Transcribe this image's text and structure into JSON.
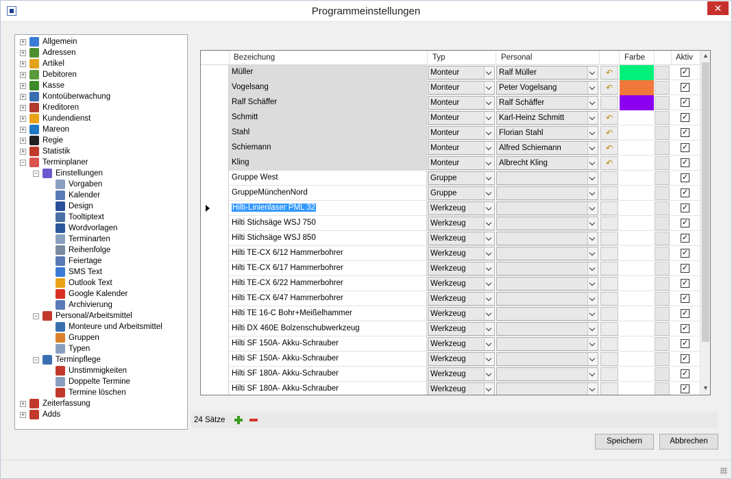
{
  "window": {
    "title": "Programmeinstellungen",
    "close_label": "✕"
  },
  "tree": {
    "nodes": [
      {
        "label": "Allgemein",
        "level": 0,
        "expander": "+",
        "icon": "grid-icon",
        "color": "#3a7bd5"
      },
      {
        "label": "Adressen",
        "level": 0,
        "expander": "+",
        "icon": "people-icon",
        "color": "#4f8f2f"
      },
      {
        "label": "Artikel",
        "level": 0,
        "expander": "+",
        "icon": "gear-sun-icon",
        "color": "#e3a21a"
      },
      {
        "label": "Debitoren",
        "level": 0,
        "expander": "+",
        "icon": "book-icon",
        "color": "#5a9a3a"
      },
      {
        "label": "Kasse",
        "level": 0,
        "expander": "+",
        "icon": "cash-icon",
        "color": "#3d8a2a"
      },
      {
        "label": "Kontoüberwachung",
        "level": 0,
        "expander": "+",
        "icon": "monitor-icon",
        "color": "#3a6fb0"
      },
      {
        "label": "Kreditoren",
        "level": 0,
        "expander": "+",
        "icon": "books-icon",
        "color": "#b03a2e"
      },
      {
        "label": "Kundendienst",
        "level": 0,
        "expander": "+",
        "icon": "service-icon",
        "color": "#e8a317"
      },
      {
        "label": "Mareon",
        "level": 0,
        "expander": "+",
        "icon": "mareon-icon",
        "color": "#1d7ac7"
      },
      {
        "label": "Regie",
        "level": 0,
        "expander": "+",
        "icon": "clapper-icon",
        "color": "#222222"
      },
      {
        "label": "Statistik",
        "level": 0,
        "expander": "+",
        "icon": "chart-icon",
        "color": "#c0392b"
      },
      {
        "label": "Terminplaner",
        "level": 0,
        "expander": "−",
        "icon": "planner-icon",
        "color": "#d9534f"
      },
      {
        "label": "Einstellungen",
        "level": 1,
        "expander": "−",
        "icon": "settings-icon",
        "color": "#6a5acd"
      },
      {
        "label": "Vorgaben",
        "level": 2,
        "expander": "",
        "icon": "document-icon",
        "color": "#8aa0c0"
      },
      {
        "label": "Kalender",
        "level": 2,
        "expander": "",
        "icon": "calendar-icon",
        "color": "#5a7ab5"
      },
      {
        "label": "Design",
        "level": 2,
        "expander": "",
        "icon": "brush-icon",
        "color": "#2a4f9a"
      },
      {
        "label": "Tooltiptext",
        "level": 2,
        "expander": "",
        "icon": "tooltip-icon",
        "color": "#4a6fa5"
      },
      {
        "label": "Wordvorlagen",
        "level": 2,
        "expander": "",
        "icon": "word-icon",
        "color": "#2b579a"
      },
      {
        "label": "Terminarten",
        "level": 2,
        "expander": "",
        "icon": "document-icon",
        "color": "#8aa0c0"
      },
      {
        "label": "Reihenfolge",
        "level": 2,
        "expander": "",
        "icon": "list-icon",
        "color": "#7a8aa0"
      },
      {
        "label": "Feiertage",
        "level": 2,
        "expander": "",
        "icon": "holiday-icon",
        "color": "#5a7ab5"
      },
      {
        "label": "SMS Text",
        "level": 2,
        "expander": "",
        "icon": "phone-icon",
        "color": "#3a7bd5"
      },
      {
        "label": "Outlook Text",
        "level": 2,
        "expander": "",
        "icon": "envelope-icon",
        "color": "#e8a317"
      },
      {
        "label": "Google Kalender",
        "level": 2,
        "expander": "",
        "icon": "google-icon",
        "color": "#d93025"
      },
      {
        "label": "Archivierung",
        "level": 2,
        "expander": "",
        "icon": "archive-icon",
        "color": "#5a7ab5"
      },
      {
        "label": "Personal/Arbeitsmittel",
        "level": 1,
        "expander": "−",
        "icon": "tools-icon",
        "color": "#c0392b"
      },
      {
        "label": "Monteure und Arbeitsmittel",
        "level": 2,
        "expander": "",
        "icon": "worker-icon",
        "color": "#3a6fb0"
      },
      {
        "label": "Gruppen",
        "level": 2,
        "expander": "",
        "icon": "group-icon",
        "color": "#d9822b"
      },
      {
        "label": "Typen",
        "level": 2,
        "expander": "",
        "icon": "document-icon",
        "color": "#8aa0c0"
      },
      {
        "label": "Terminpflege",
        "level": 1,
        "expander": "−",
        "icon": "clipboard-icon",
        "color": "#3a6fb0"
      },
      {
        "label": "Unstimmigkeiten",
        "level": 2,
        "expander": "",
        "icon": "flag-icon",
        "color": "#c0392b"
      },
      {
        "label": "Doppelte Termine",
        "level": 2,
        "expander": "",
        "icon": "documents-icon",
        "color": "#8aa0c0"
      },
      {
        "label": "Termine löschen",
        "level": 2,
        "expander": "",
        "icon": "delete-doc-icon",
        "color": "#c0392b"
      },
      {
        "label": "Zeiterfassung",
        "level": 0,
        "expander": "+",
        "icon": "clock-icon",
        "color": "#c0392b"
      },
      {
        "label": "Adds",
        "level": 0,
        "expander": "+",
        "icon": "adds-icon",
        "color": "#c0392b"
      }
    ]
  },
  "grid": {
    "headers": {
      "bezeichnung": "Bezeichung",
      "typ": "Typ",
      "personal": "Personal",
      "farbe": "Farbe",
      "aktiv": "Aktiv"
    },
    "current_row_marker": "row-pointer-icon",
    "rows": [
      {
        "name": "Müller",
        "typ": "Monteur",
        "personal": "Ralf Müller",
        "color": "#00f07a",
        "gray": true,
        "undo": true,
        "checked": true
      },
      {
        "name": "Vogelsang",
        "typ": "Monteur",
        "personal": "Peter Vogelsang",
        "color": "#f2773b",
        "gray": true,
        "undo": true,
        "checked": true
      },
      {
        "name": "Ralf Schäffer",
        "typ": "Monteur",
        "personal": "Ralf Schäffer",
        "color": "#8b00f0",
        "gray": true,
        "undo": false,
        "checked": true
      },
      {
        "name": "Schmitt",
        "typ": "Monteur",
        "personal": "Karl-Heinz Schmitt",
        "color": "",
        "gray": true,
        "undo": true,
        "checked": true
      },
      {
        "name": "Stahl",
        "typ": "Monteur",
        "personal": "Florian Stahl",
        "color": "",
        "gray": true,
        "undo": true,
        "checked": true
      },
      {
        "name": "Schiemann",
        "typ": "Monteur",
        "personal": "Alfred Schiemann",
        "color": "",
        "gray": true,
        "undo": true,
        "checked": true
      },
      {
        "name": "Kling",
        "typ": "Monteur",
        "personal": "Albrecht Kling",
        "color": "",
        "gray": true,
        "undo": true,
        "checked": true
      },
      {
        "name": "Gruppe West",
        "typ": "Gruppe",
        "personal": "",
        "color": "",
        "gray": false,
        "undo": false,
        "checked": true
      },
      {
        "name": "GruppeMünchenNord",
        "typ": "Gruppe",
        "personal": "",
        "color": "",
        "gray": false,
        "undo": false,
        "checked": true
      },
      {
        "name": "Hilti-Linienlaser PML 32",
        "typ": "Werkzeug",
        "personal": "",
        "color": "",
        "gray": false,
        "undo": false,
        "checked": true,
        "selected": true
      },
      {
        "name": "Hilti Stichsäge WSJ 750",
        "typ": "Werkzeug",
        "personal": "",
        "color": "",
        "gray": false,
        "undo": false,
        "checked": true
      },
      {
        "name": "Hilti Stichsäge WSJ 850",
        "typ": "Werkzeug",
        "personal": "",
        "color": "",
        "gray": false,
        "undo": false,
        "checked": true
      },
      {
        "name": "Hilti TE-CX 6/12 Hammerbohrer",
        "typ": "Werkzeug",
        "personal": "",
        "color": "",
        "gray": false,
        "undo": false,
        "checked": true
      },
      {
        "name": "Hilti TE-CX 6/17 Hammerbohrer",
        "typ": "Werkzeug",
        "personal": "",
        "color": "",
        "gray": false,
        "undo": false,
        "checked": true
      },
      {
        "name": "Hilti TE-CX 6/22 Hammerbohrer",
        "typ": "Werkzeug",
        "personal": "",
        "color": "",
        "gray": false,
        "undo": false,
        "checked": true
      },
      {
        "name": "Hilti TE-CX 6/47 Hammerbohrer",
        "typ": "Werkzeug",
        "personal": "",
        "color": "",
        "gray": false,
        "undo": false,
        "checked": true
      },
      {
        "name": "Hilti TE 16-C Bohr+Meißelhammer",
        "typ": "Werkzeug",
        "personal": "",
        "color": "",
        "gray": false,
        "undo": false,
        "checked": true
      },
      {
        "name": "Hilti DX 460E Bolzenschubwerkzeug",
        "typ": "Werkzeug",
        "personal": "",
        "color": "",
        "gray": false,
        "undo": false,
        "checked": true
      },
      {
        "name": "Hilti SF 150A- Akku-Schrauber",
        "typ": "Werkzeug",
        "personal": "",
        "color": "",
        "gray": false,
        "undo": false,
        "checked": true
      },
      {
        "name": "Hilti SF 150A- Akku-Schrauber",
        "typ": "Werkzeug",
        "personal": "",
        "color": "",
        "gray": false,
        "undo": false,
        "checked": true
      },
      {
        "name": "Hilti SF 180A- Akku-Schrauber",
        "typ": "Werkzeug",
        "personal": "",
        "color": "",
        "gray": false,
        "undo": false,
        "checked": true
      },
      {
        "name": "Hilti SF 180A- Akku-Schrauber",
        "typ": "Werkzeug",
        "personal": "",
        "color": "",
        "gray": false,
        "undo": false,
        "checked": true
      }
    ]
  },
  "footer": {
    "record_count": "24 Sätze",
    "add_icon": "plus-icon",
    "remove_icon": "minus-icon"
  },
  "buttons": {
    "save": "Speichern",
    "cancel": "Abbrechen"
  },
  "undo_glyph": "↶",
  "check_glyph": "✓"
}
